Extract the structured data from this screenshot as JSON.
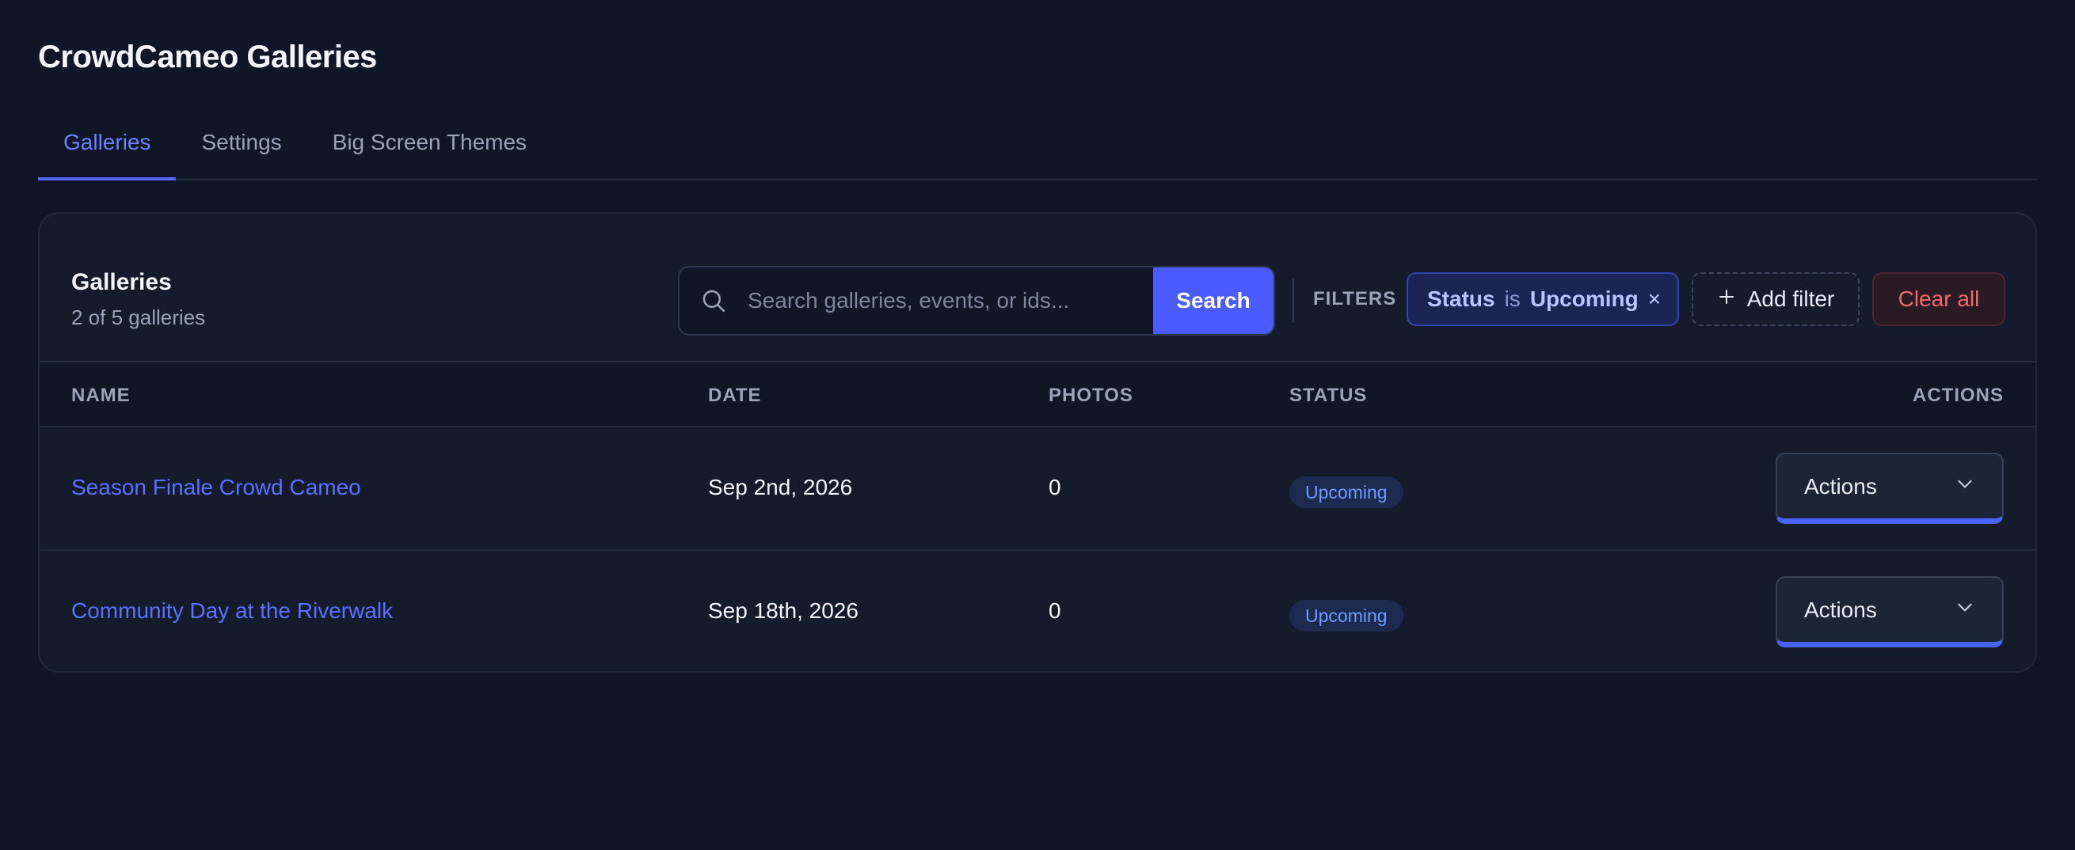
{
  "app": {
    "title": "CrowdCameo Galleries"
  },
  "tabs": [
    {
      "label": "Galleries",
      "active": true
    },
    {
      "label": "Settings",
      "active": false
    },
    {
      "label": "Big Screen Themes",
      "active": false
    }
  ],
  "card": {
    "title": "Galleries",
    "subtitle": "2 of 5 galleries"
  },
  "search": {
    "placeholder": "Search galleries, events, or ids...",
    "value": "",
    "button_label": "Search",
    "icon": "search-icon"
  },
  "filters": {
    "label": "FILTERS",
    "active": [
      {
        "field": "Status",
        "operator": "is",
        "value": "Upcoming",
        "remove_glyph": "×"
      }
    ],
    "add_label": "Add filter",
    "clear_label": "Clear all"
  },
  "table": {
    "columns": [
      "NAME",
      "DATE",
      "PHOTOS",
      "STATUS",
      "ACTIONS"
    ],
    "rows": [
      {
        "name": "Season Finale Crowd Cameo",
        "date": "Sep 2nd, 2026",
        "photos": "0",
        "status": "Upcoming",
        "action_label": "Actions"
      },
      {
        "name": "Community Day at the Riverwalk",
        "date": "Sep 18th, 2026",
        "photos": "0",
        "status": "Upcoming",
        "action_label": "Actions"
      }
    ]
  },
  "colors": {
    "background": "#0f1626",
    "card": "#141c2c",
    "accent": "#4a5cff",
    "link": "#5c70ff",
    "danger": "#f26b6b",
    "badge_text": "#6f9bff"
  }
}
